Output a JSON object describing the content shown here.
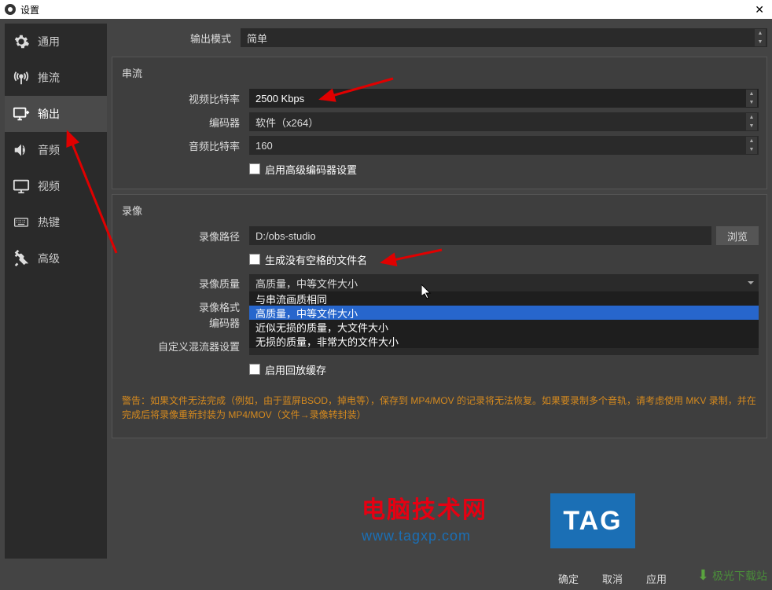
{
  "titlebar": {
    "title": "设置"
  },
  "sidebar": {
    "items": [
      {
        "label": "通用"
      },
      {
        "label": "推流"
      },
      {
        "label": "输出"
      },
      {
        "label": "音频"
      },
      {
        "label": "视频"
      },
      {
        "label": "热键"
      },
      {
        "label": "高级"
      }
    ]
  },
  "output_mode": {
    "label": "输出模式",
    "value": "简单"
  },
  "streaming": {
    "legend": "串流",
    "video_bitrate_label": "视频比特率",
    "video_bitrate_value": "2500 Kbps",
    "encoder_label": "编码器",
    "encoder_value": "软件（x264）",
    "audio_bitrate_label": "音频比特率",
    "audio_bitrate_value": "160",
    "advanced_checkbox": "启用高级编码器设置"
  },
  "recording": {
    "legend": "录像",
    "path_label": "录像路径",
    "path_value": "D:/obs-studio",
    "browse": "浏览",
    "nospace_checkbox": "生成没有空格的文件名",
    "quality_label": "录像质量",
    "quality_value": "高质量，中等文件大小",
    "quality_options": [
      "与串流画质相同",
      "高质量，中等文件大小",
      "近似无损的质量，大文件大小",
      "无损的质量，非常大的文件大小"
    ],
    "format_label": "录像格式",
    "encoder_label": "编码器",
    "muxer_label": "自定义混流器设置",
    "replay_checkbox": "启用回放缓存"
  },
  "warning": "警告：如果文件无法完成（例如，由于蓝屏BSOD，掉电等），保存到 MP4/MOV 的记录将无法恢复。如果要录制多个音轨，请考虑使用 MKV 录制，并在完成后将录像重新封装为 MP4/MOV（文件→录像转封装）",
  "footer": {
    "ok": "确定",
    "cancel": "取消",
    "apply": "应用"
  },
  "watermark1": {
    "top": "电脑技术网",
    "bot": "www.tagxp.com"
  },
  "watermark2": "TAG",
  "watermark3": "极光下载站"
}
